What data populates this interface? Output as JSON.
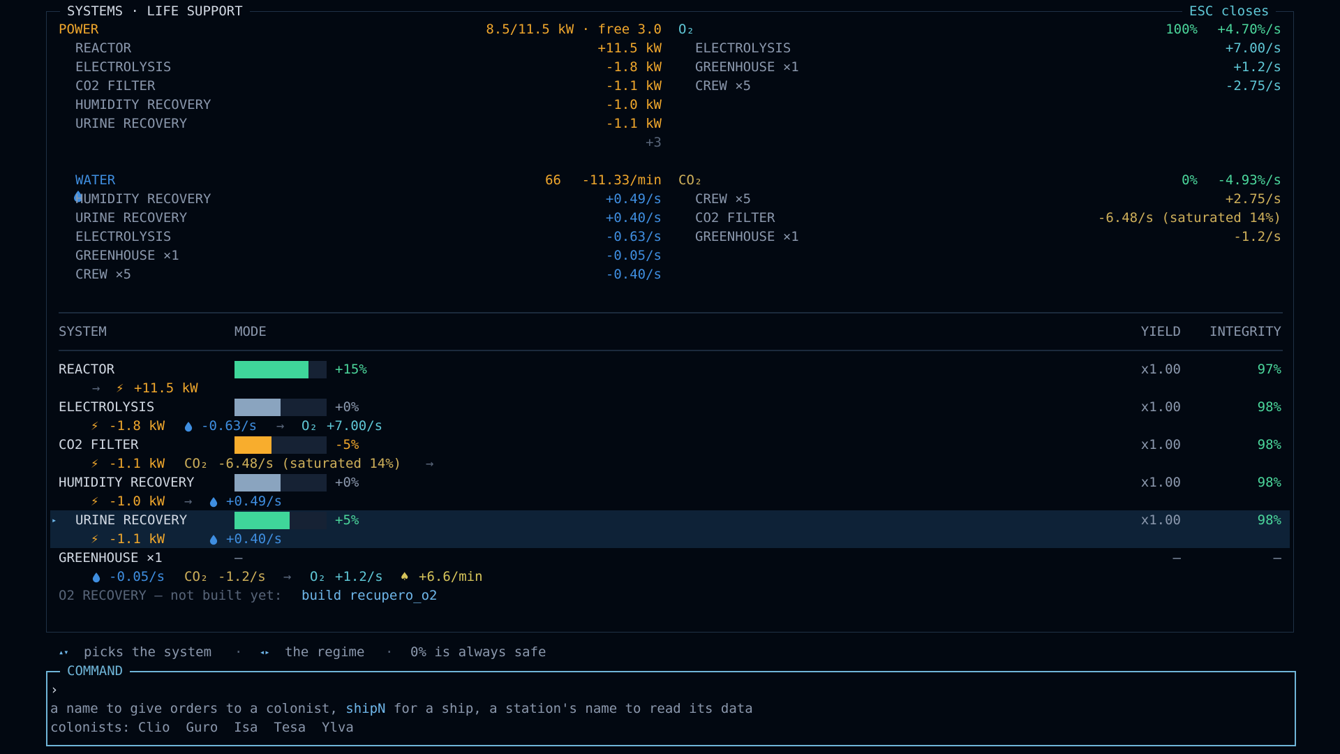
{
  "header": {
    "title": "SYSTEMS · LIFE SUPPORT",
    "close_hint": "ESC closes"
  },
  "power": {
    "label": "POWER",
    "summary": "8.5/11.5 kW · free 3.0",
    "items": [
      {
        "name": "REACTOR",
        "value": "+11.5 kW"
      },
      {
        "name": "ELECTROLYSIS",
        "value": "-1.8 kW"
      },
      {
        "name": "CO2 FILTER",
        "value": "-1.1 kW"
      },
      {
        "name": "HUMIDITY RECOVERY",
        "value": "-1.0 kW"
      },
      {
        "name": "URINE RECOVERY",
        "value": "-1.1 kW"
      }
    ],
    "more": "+3"
  },
  "o2": {
    "label": "O₂",
    "level": "100%",
    "rate": "+4.70%/s",
    "items": [
      {
        "name": "ELECTROLYSIS",
        "value": "+7.00/s"
      },
      {
        "name": "GREENHOUSE ×1",
        "value": "+1.2/s"
      },
      {
        "name": "CREW ×5",
        "value": "-2.75/s"
      }
    ]
  },
  "water": {
    "label": "WATER",
    "amount": "66",
    "rate": "-11.33/min",
    "items": [
      {
        "name": "HUMIDITY RECOVERY",
        "value": "+0.49/s"
      },
      {
        "name": "URINE RECOVERY",
        "value": "+0.40/s"
      },
      {
        "name": "ELECTROLYSIS",
        "value": "-0.63/s"
      },
      {
        "name": "GREENHOUSE ×1",
        "value": "-0.05/s"
      },
      {
        "name": "CREW ×5",
        "value": "-0.40/s"
      }
    ]
  },
  "co2": {
    "label": "CO₂",
    "level": "0%",
    "rate": "-4.93%/s",
    "items": [
      {
        "name": "CREW ×5",
        "value": "+2.75/s"
      },
      {
        "name": "CO2 FILTER",
        "value": "-6.48/s (saturated 14%)"
      },
      {
        "name": "GREENHOUSE ×1",
        "value": "-1.2/s"
      }
    ]
  },
  "table": {
    "headers": {
      "system": "SYSTEM",
      "mode": "MODE",
      "yield": "YIELD",
      "integrity": "INTEGRITY"
    },
    "rows": [
      {
        "name": "REACTOR",
        "mode_pct": "+15%",
        "mode_level": 0.8,
        "bar_color": "#3fd69a",
        "yield": "x1.00",
        "integrity": "97%",
        "d1": "+11.5 kW"
      },
      {
        "name": "ELECTROLYSIS",
        "mode_pct": "+0%",
        "mode_level": 0.5,
        "bar_color": "#8aa4bf",
        "yield": "x1.00",
        "integrity": "98%",
        "d1": "-1.8 kW",
        "d2": "-0.63/s",
        "d3_label": "O₂",
        "d3": "+7.00/s"
      },
      {
        "name": "CO2 FILTER",
        "mode_pct": "-5%",
        "mode_level": 0.4,
        "bar_color": "#f8ad2d",
        "yield": "x1.00",
        "integrity": "98%",
        "d1": "-1.1 kW",
        "d2_label": "CO₂",
        "d2": "-6.48/s (saturated 14%)"
      },
      {
        "name": "HUMIDITY RECOVERY",
        "mode_pct": "+0%",
        "mode_level": 0.5,
        "bar_color": "#8aa4bf",
        "yield": "x1.00",
        "integrity": "98%",
        "d1": "-1.0 kW",
        "d2": "+0.49/s"
      },
      {
        "name": "URINE RECOVERY",
        "mode_pct": "+5%",
        "mode_level": 0.6,
        "bar_color": "#3fd69a",
        "yield": "x1.00",
        "integrity": "98%",
        "d1": "-1.1 kW",
        "d2": "+0.40/s",
        "selected_marker": "▸"
      },
      {
        "name": "GREENHOUSE ×1",
        "mode_pct": "—",
        "yield": "—",
        "integrity": "—",
        "d1": "-0.05/s",
        "d2_label": "CO₂",
        "d2": "-1.2/s",
        "d3_label": "O₂",
        "d3": "+1.2/s",
        "d4": "+6.6/min"
      }
    ],
    "not_built_text": "O2 RECOVERY — not built yet: ",
    "not_built_cmd": "build recupero_o2"
  },
  "hint": {
    "updown_icon": "▴▾",
    "updown_text": "picks the system",
    "leftright_icon": "◂▸",
    "leftright_text": "the regime",
    "safe_text": "0% is always safe",
    "dot": "·"
  },
  "command": {
    "label": "COMMAND",
    "prompt": "›",
    "help_pre": "a name to give orders to a colonist, ",
    "help_ship": "shipN",
    "help_post": " for a ship, a station's name to read its data",
    "colonists_label": "colonists:",
    "colonists": [
      "Clio",
      "Guro",
      "Isa",
      "Tesa",
      "Ylva"
    ]
  },
  "colors": {
    "orange": "#f0a72c",
    "cyan": "#5fc7d6",
    "green": "#4bd69b",
    "blue": "#3f8ee0",
    "border": "#6fb5d8"
  }
}
